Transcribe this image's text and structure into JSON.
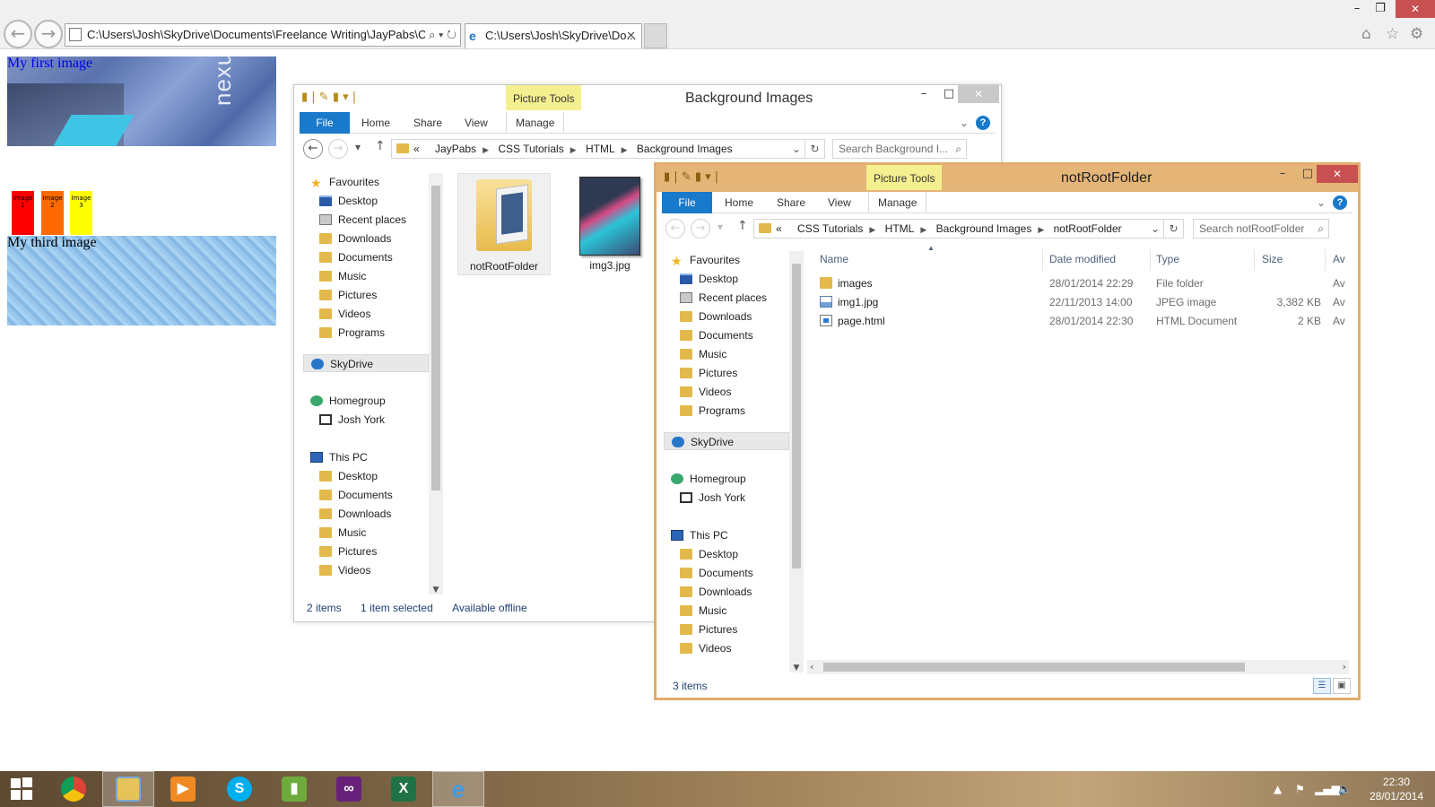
{
  "browser": {
    "address": "C:\\Users\\Josh\\SkyDrive\\Documents\\Freelance Writing\\JayPabs\\CSS`",
    "tab_title": "C:\\Users\\Josh\\SkyDrive\\Do...",
    "addr_tools": "⌕ ▾ ↻",
    "tab_close": "✕",
    "minimize": "–",
    "restore": "❐",
    "close": "✕"
  },
  "page": {
    "caption1": "My first image",
    "caption3": "My third image",
    "img1_logo": "nexus",
    "swatches": [
      {
        "label": "Image 1",
        "color": "#ff0000"
      },
      {
        "label": "Image 2",
        "color": "#ff6a00"
      },
      {
        "label": "Image 3",
        "color": "#ffff00"
      }
    ]
  },
  "explorer_common": {
    "picture_tools": "Picture Tools",
    "tabs": {
      "file": "File",
      "home": "Home",
      "share": "Share",
      "view": "View",
      "manage": "Manage"
    },
    "help": "?",
    "minimize": "–",
    "maximize": "□",
    "close": "✕",
    "nav": {
      "favourites": "Favourites",
      "desktop": "Desktop",
      "recent_places": "Recent places",
      "downloads": "Downloads",
      "documents": "Documents",
      "music": "Music",
      "pictures": "Pictures",
      "videos": "Videos",
      "programs": "Programs",
      "skydrive": "SkyDrive",
      "homegroup": "Homegroup",
      "josh_york": "Josh York",
      "this_pc": "This PC"
    }
  },
  "window_a": {
    "title": "Background Images",
    "breadcrumb": [
      "«",
      "JayPabs",
      "CSS Tutorials",
      "HTML",
      "Background Images"
    ],
    "search_placeholder": "Search Background I...",
    "items": [
      {
        "name": "notRootFolder"
      },
      {
        "name": "img3.jpg"
      }
    ],
    "status": {
      "items": "2 items",
      "selected": "1 item selected",
      "offline": "Available offline"
    }
  },
  "window_b": {
    "title": "notRootFolder",
    "breadcrumb": [
      "«",
      "CSS Tutorials",
      "HTML",
      "Background Images",
      "notRootFolder"
    ],
    "search_placeholder": "Search notRootFolder",
    "columns": {
      "name": "Name",
      "date": "Date modified",
      "type": "Type",
      "size": "Size",
      "av": "Av"
    },
    "rows": [
      {
        "name": "images",
        "date": "28/01/2014 22:29",
        "type": "File folder",
        "size": "",
        "av": "Av",
        "icon": "folder"
      },
      {
        "name": "img1.jpg",
        "date": "22/11/2013 14:00",
        "type": "JPEG image",
        "size": "3,382 KB",
        "av": "Av",
        "icon": "jpg"
      },
      {
        "name": "page.html",
        "date": "28/01/2014 22:30",
        "type": "HTML Document",
        "size": "2 KB",
        "av": "Av",
        "icon": "html"
      }
    ],
    "status": {
      "items": "3 items"
    }
  },
  "taskbar": {
    "time": "22:30",
    "date": "28/01/2014"
  }
}
